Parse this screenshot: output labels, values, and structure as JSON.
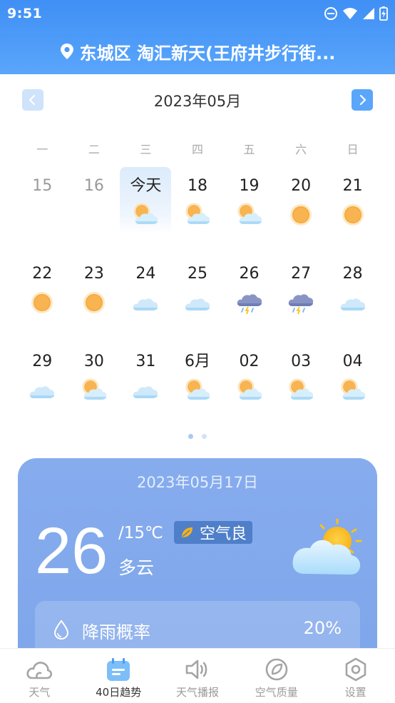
{
  "status_bar": {
    "time": "9:51"
  },
  "header": {
    "location": "东城区 淘汇新天(王府井步行街..."
  },
  "calendar": {
    "month_title": "2023年05月",
    "weekdays": [
      "一",
      "二",
      "三",
      "四",
      "五",
      "六",
      "日"
    ],
    "days": [
      {
        "label": "15",
        "icon": "",
        "past": true
      },
      {
        "label": "16",
        "icon": "",
        "past": true
      },
      {
        "label": "今天",
        "icon": "partly-cloudy-icon",
        "today": true
      },
      {
        "label": "18",
        "icon": "partly-cloudy-icon"
      },
      {
        "label": "19",
        "icon": "partly-cloudy-icon"
      },
      {
        "label": "20",
        "icon": "sunny-icon"
      },
      {
        "label": "21",
        "icon": "sunny-icon"
      },
      {
        "label": "22",
        "icon": "sunny-icon"
      },
      {
        "label": "23",
        "icon": "sunny-icon"
      },
      {
        "label": "24",
        "icon": "cloudy-icon"
      },
      {
        "label": "25",
        "icon": "cloudy-icon"
      },
      {
        "label": "26",
        "icon": "thunderstorm-icon"
      },
      {
        "label": "27",
        "icon": "thunderstorm-icon"
      },
      {
        "label": "28",
        "icon": "cloudy-icon"
      },
      {
        "label": "29",
        "icon": "cloudy-icon"
      },
      {
        "label": "30",
        "icon": "partly-cloudy-icon"
      },
      {
        "label": "31",
        "icon": "cloudy-icon"
      },
      {
        "label": "6月",
        "icon": "partly-cloudy-icon"
      },
      {
        "label": "02",
        "icon": "partly-cloudy-icon"
      },
      {
        "label": "03",
        "icon": "partly-cloudy-icon"
      },
      {
        "label": "04",
        "icon": "partly-cloudy-icon"
      }
    ]
  },
  "detail": {
    "date": "2023年05月17日",
    "temperature": "26",
    "temp_range": "/15℃",
    "air_quality": "空气良",
    "condition": "多云",
    "condition_icon": "partly-cloudy-icon",
    "rain_label": "降雨概率",
    "rain_value": "20%"
  },
  "tabs": [
    {
      "label": "天气",
      "icon": "weather-cloud-icon"
    },
    {
      "label": "40日趋势",
      "icon": "calendar-icon",
      "active": true
    },
    {
      "label": "天气播报",
      "icon": "speaker-icon"
    },
    {
      "label": "空气质量",
      "icon": "air-quality-icon"
    },
    {
      "label": "设置",
      "icon": "settings-icon"
    }
  ],
  "colors": {
    "header_blue": "#4a9af8",
    "card_blue": "#84aaed",
    "accent_blue": "#5aa6fb"
  }
}
